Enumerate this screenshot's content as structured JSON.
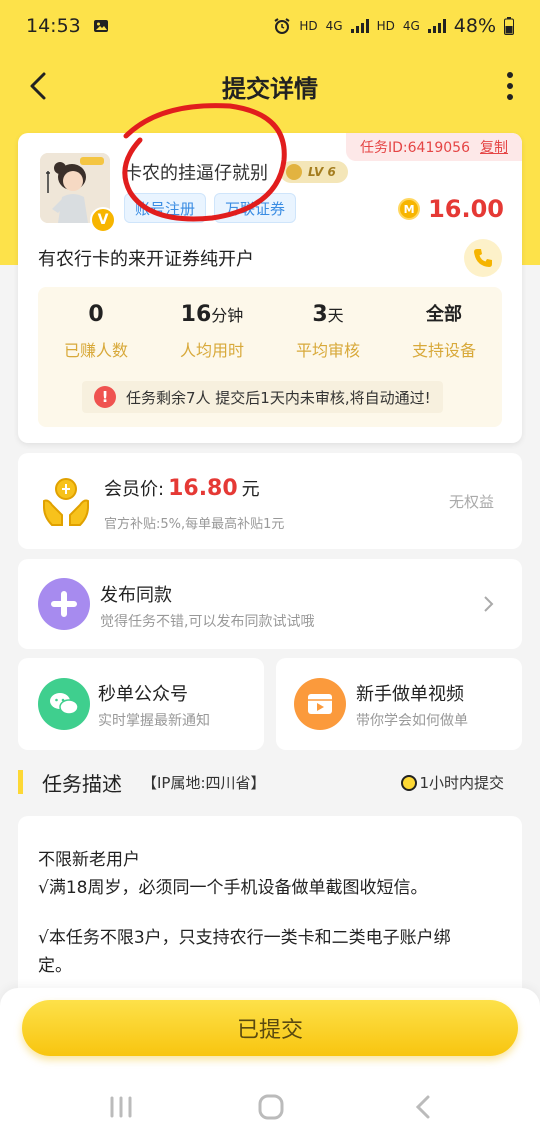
{
  "status_bar": {
    "time": "14:53",
    "battery": "48%",
    "hd1": "HD",
    "net1": "4G",
    "hd2": "HD",
    "net2": "4G"
  },
  "header": {
    "title": "提交详情"
  },
  "task": {
    "id_label": "任务ID:6419056",
    "copy_label": "复制",
    "user_name": "卡农的挂逼仔就别",
    "level": "LV 6",
    "tags": [
      "账号注册",
      "万联证券"
    ],
    "reward": "16.00",
    "coin_letter": "M",
    "vip_letter": "V",
    "title": "有农行卡的来开证券纯开户",
    "stats": [
      {
        "value": "0",
        "unit": "",
        "label": "已赚人数"
      },
      {
        "value": "16",
        "unit": "分钟",
        "label": "人均用时"
      },
      {
        "value": "3",
        "unit": "天",
        "label": "平均审核"
      },
      {
        "value": "全部",
        "unit": "",
        "label": "支持设备"
      }
    ],
    "notice": "任务剩余7人  提交后1天内未审核,将自动通过!"
  },
  "member": {
    "label": "会员价:",
    "amount": "16.80",
    "unit": "元",
    "sub": "官方补贴:5%,每单最高补贴1元",
    "no_rights": "无权益"
  },
  "publish": {
    "title": "发布同款",
    "sub": "觉得任务不错,可以发布同款试试哦"
  },
  "wechat": {
    "title": "秒单公众号",
    "sub": "实时掌握最新通知"
  },
  "video": {
    "title": "新手做单视频",
    "sub": "带你学会如何做单"
  },
  "description": {
    "section_title": "任务描述",
    "ip_location": "【IP属地:四川省】",
    "deadline": "1小时内提交",
    "lines": [
      "不限新老用户",
      "√满18周岁，必须同一个手机设备做单截图收短信。",
      "√本任务不限3户，只支持农行一类卡和二类电子账户绑",
      "定。"
    ]
  },
  "submit": {
    "label": "已提交"
  },
  "colors": {
    "brand_yellow": "#fde24a",
    "price_red": "#e53935",
    "stat_label": "#d8a93a",
    "annotation_red": "#e11d1d"
  }
}
